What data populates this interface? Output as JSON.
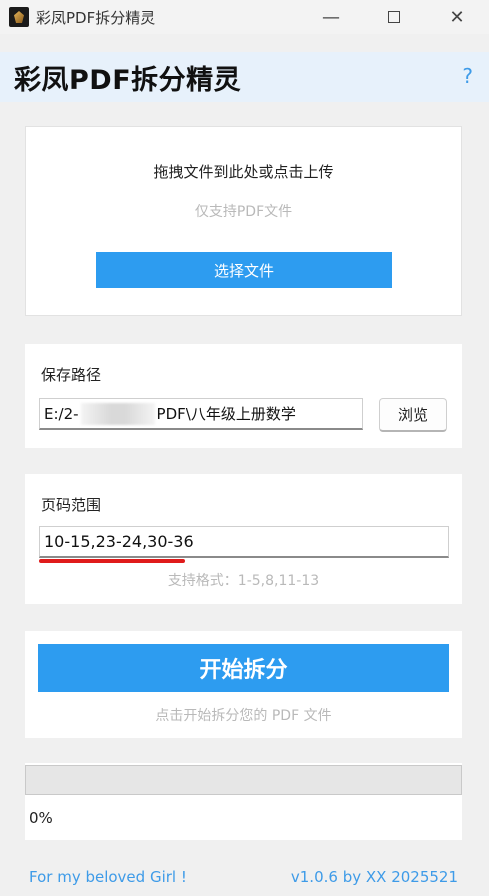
{
  "window": {
    "title": "彩凤PDF拆分精灵",
    "minimize_glyph": "—",
    "close_glyph": "✕"
  },
  "header": {
    "title": "彩凤PDF拆分精灵",
    "help_glyph": "?"
  },
  "upload": {
    "drop_text": "拖拽文件到此处或点击上传",
    "hint": "仅支持PDF文件",
    "select_button": "选择文件"
  },
  "save": {
    "label": "保存路径",
    "path_prefix": "E:/2-",
    "path_suffix": "PDF\\八年级上册数学",
    "browse_button": "浏览"
  },
  "range": {
    "label": "页码范围",
    "value": "10-15,23-24,30-36",
    "format_hint": "支持格式：1-5,8,11-13"
  },
  "start": {
    "button": "开始拆分",
    "hint": "点击开始拆分您的 PDF 文件"
  },
  "progress": {
    "percent": 0,
    "text": "0%"
  },
  "footer": {
    "left": "For my beloved Girl !",
    "right": "v1.0.6 by XX 2025521"
  },
  "colors": {
    "accent": "#2d9cf0",
    "link": "#3e9be8",
    "header_bg": "#e7f1fb",
    "annotation_red": "#e01b1b"
  }
}
